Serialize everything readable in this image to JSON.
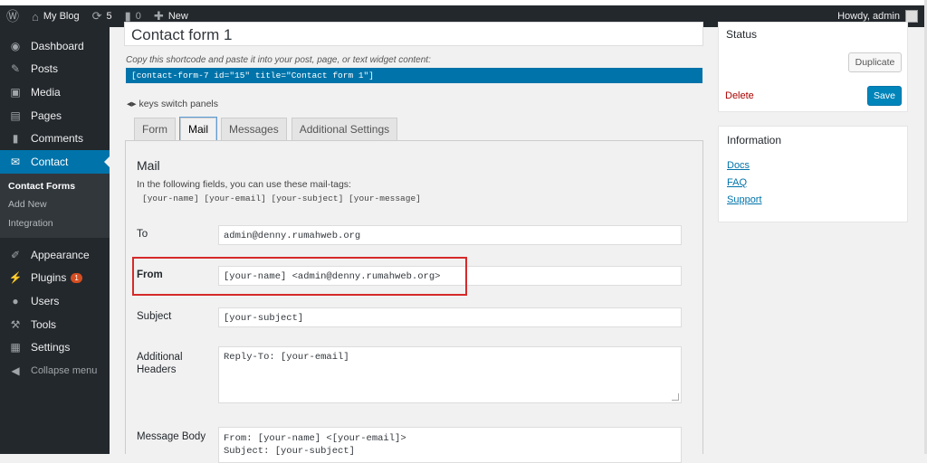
{
  "adminbar": {
    "site_name": "My Blog",
    "updates_count": "5",
    "comments_count": "0",
    "new_label": "New",
    "howdy": "Howdy, admin"
  },
  "sidebar": {
    "items": [
      {
        "label": "Dashboard",
        "icon": "dashboard-icon",
        "glyph": "◉"
      },
      {
        "label": "Posts",
        "icon": "pin-icon",
        "glyph": "✎"
      },
      {
        "label": "Media",
        "icon": "media-icon",
        "glyph": "▣"
      },
      {
        "label": "Pages",
        "icon": "pages-icon",
        "glyph": "▤"
      },
      {
        "label": "Comments",
        "icon": "comments-icon",
        "glyph": "▮"
      },
      {
        "label": "Contact",
        "icon": "mail-icon",
        "glyph": "✉"
      }
    ],
    "submenu": [
      "Contact Forms",
      "Add New",
      "Integration"
    ],
    "items2": [
      {
        "label": "Appearance",
        "icon": "brush-icon",
        "glyph": "✐"
      },
      {
        "label": "Plugins",
        "icon": "plug-icon",
        "glyph": "⚡"
      },
      {
        "label": "Users",
        "icon": "user-icon",
        "glyph": "●"
      },
      {
        "label": "Tools",
        "icon": "wrench-icon",
        "glyph": "⚒"
      },
      {
        "label": "Settings",
        "icon": "settings-icon",
        "glyph": "▦"
      }
    ],
    "plugins_badge": "1",
    "collapse": "Collapse menu"
  },
  "form": {
    "title": "Contact form 1",
    "hint": "Copy this shortcode and paste it into your post, page, or text widget content:",
    "shortcode": "[contact-form-7 id=\"15\" title=\"Contact form 1\"]",
    "keys": "keys switch panels",
    "tabs": [
      "Form",
      "Mail",
      "Messages",
      "Additional Settings"
    ]
  },
  "mail": {
    "title": "Mail",
    "desc": "In the following fields, you can use these mail-tags:",
    "mailtags": "[your-name] [your-email] [your-subject] [your-message]",
    "to_label": "To",
    "to_value": "admin@denny.rumahweb.org",
    "from_label": "From",
    "from_value": "[your-name] <admin@denny.rumahweb.org>",
    "subject_label": "Subject",
    "subject_value": "[your-subject]",
    "headers_label_1": "Additional",
    "headers_label_2": "Headers",
    "headers_value": "Reply-To: [your-email]",
    "body_label": "Message Body",
    "body_line_1": "From: [your-name] <[your-email]>",
    "body_line_2": "Subject: [your-subject]"
  },
  "status_box": {
    "title": "Status",
    "duplicate": "Duplicate",
    "delete": "Delete",
    "save": "Save"
  },
  "info_box": {
    "title": "Information",
    "links": [
      "Docs",
      "FAQ",
      "Support"
    ]
  },
  "colors": {
    "sidebar": "#23282d",
    "accent": "#0073aa",
    "highlight": "#d62a2a"
  }
}
